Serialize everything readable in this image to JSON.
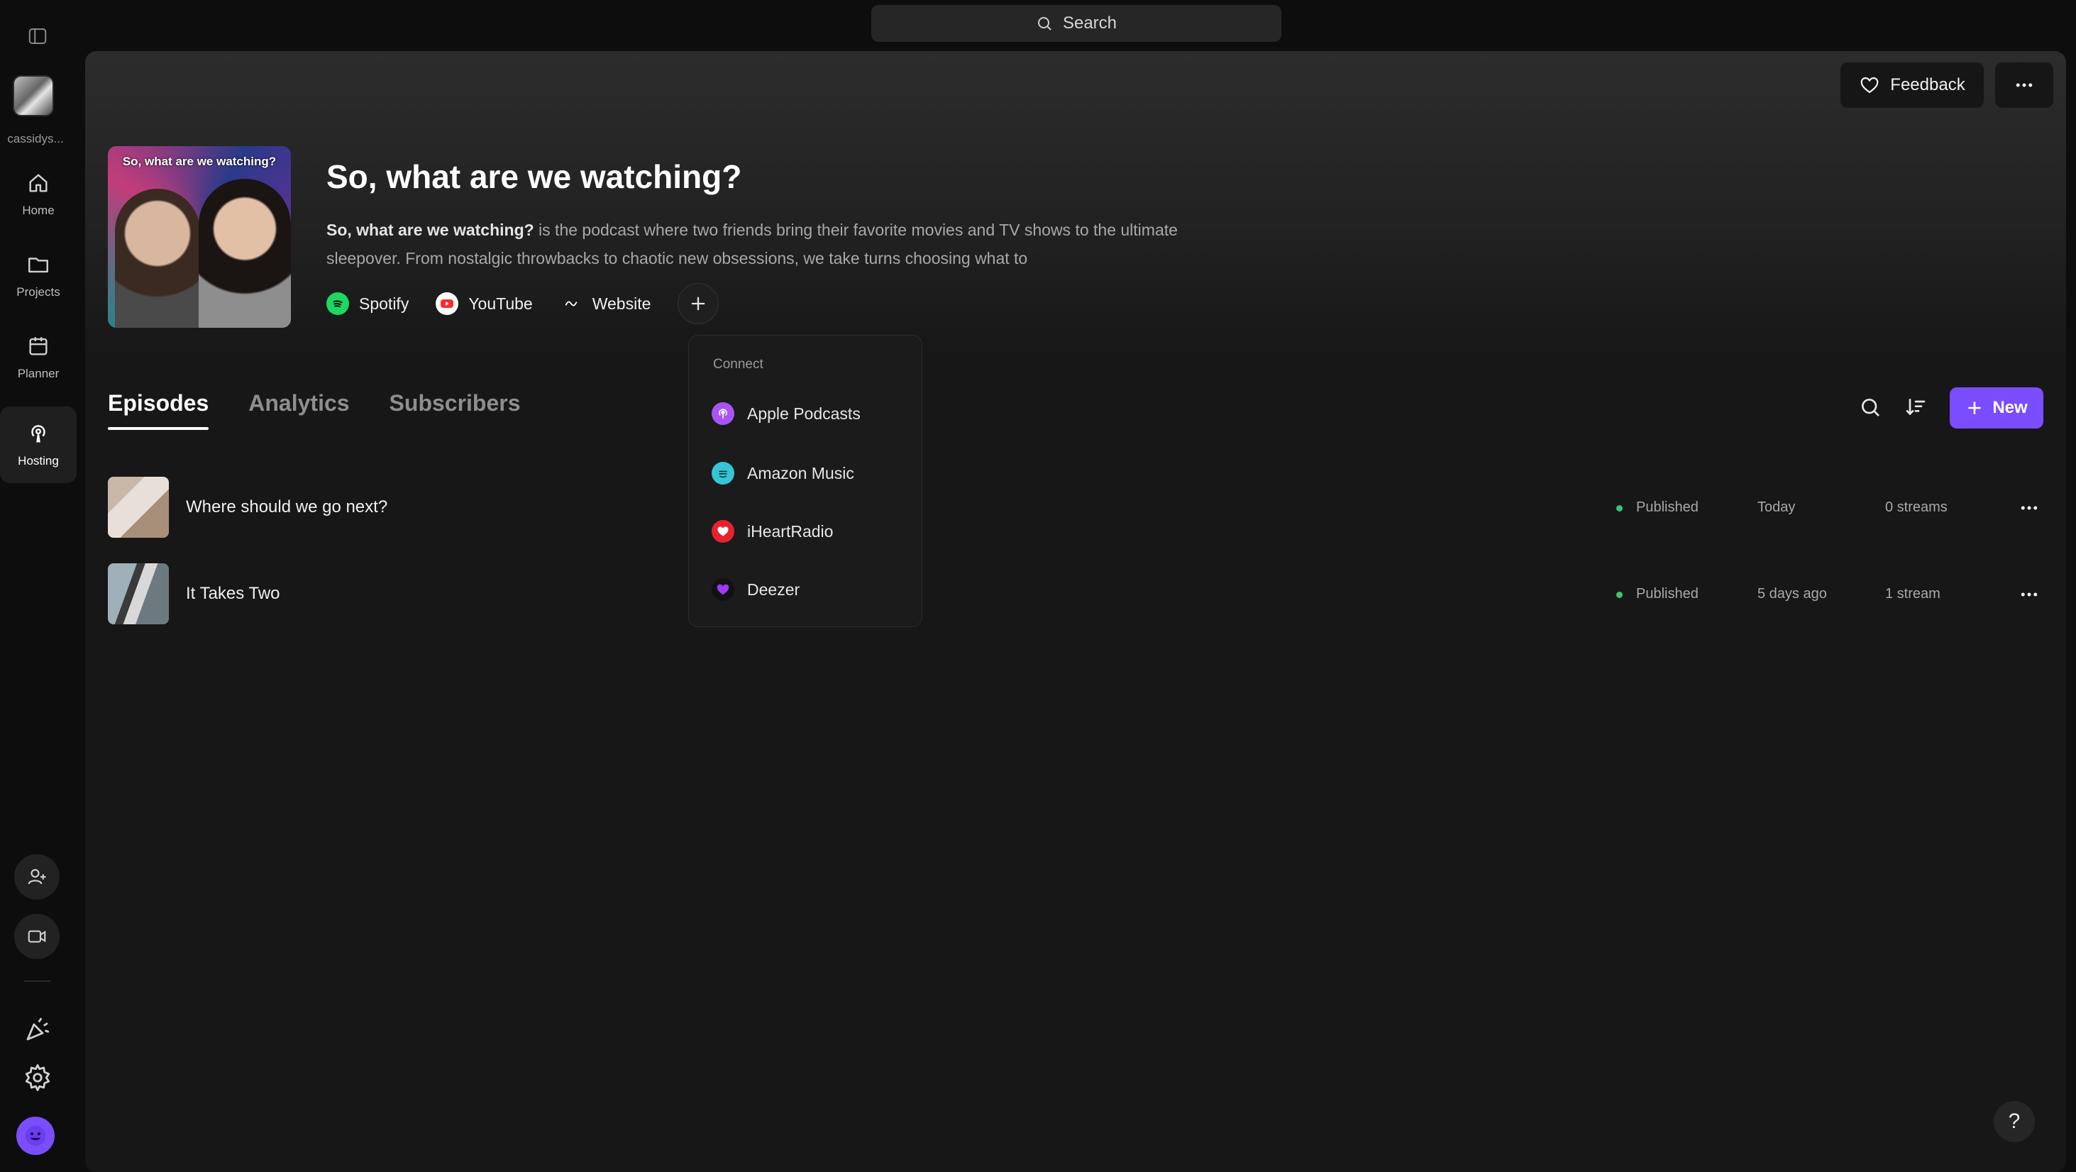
{
  "sidebar": {
    "username": "cassidys...",
    "nav": [
      {
        "label": "Home",
        "icon": "home-icon"
      },
      {
        "label": "Projects",
        "icon": "folder-icon"
      },
      {
        "label": "Planner",
        "icon": "calendar-icon"
      },
      {
        "label": "Hosting",
        "icon": "podcast-icon",
        "active": true
      }
    ],
    "bottom_icons": [
      "add-user-icon",
      "video-icon",
      "party-icon",
      "gear-icon",
      "smiley-avatar-icon"
    ]
  },
  "topbar": {
    "search_label": "Search"
  },
  "header": {
    "feedback_label": "Feedback",
    "cover_text": "So, what are we watching?",
    "title": "So, what are we watching?",
    "description_bold": "So, what are we watching?",
    "description_rest": " is the podcast where two friends bring their favorite movies and TV shows to the ultimate sleepover. From nostalgic throwbacks to chaotic new obsessions, we take turns choosing what to",
    "links": [
      {
        "label": "Spotify",
        "icon": "spotify-icon",
        "color": "#1ed760"
      },
      {
        "label": "YouTube",
        "icon": "youtube-icon",
        "color": "#ff2a2a"
      },
      {
        "label": "Website",
        "icon": "website-icon",
        "color": "#ffffff"
      }
    ]
  },
  "connect_menu": {
    "header": "Connect",
    "items": [
      {
        "label": "Apple Podcasts",
        "icon": "apple-podcasts-icon",
        "color": "#a855f7"
      },
      {
        "label": "Amazon Music",
        "icon": "amazon-music-icon",
        "color": "#37c4d6"
      },
      {
        "label": "iHeartRadio",
        "icon": "iheartradio-icon",
        "color": "#e5222d"
      },
      {
        "label": "Deezer",
        "icon": "deezer-icon",
        "color": "#a238ff"
      }
    ]
  },
  "tabs": [
    {
      "label": "Episodes",
      "active": true
    },
    {
      "label": "Analytics"
    },
    {
      "label": "Subscribers"
    }
  ],
  "toolbar": {
    "new_label": "New"
  },
  "episodes": [
    {
      "title": "Where should we go next?",
      "status": "Published",
      "date": "Today",
      "streams": "0 streams"
    },
    {
      "title": "It Takes Two",
      "status": "Published",
      "date": "5 days ago",
      "streams": "1 stream"
    }
  ],
  "help_label": "?"
}
